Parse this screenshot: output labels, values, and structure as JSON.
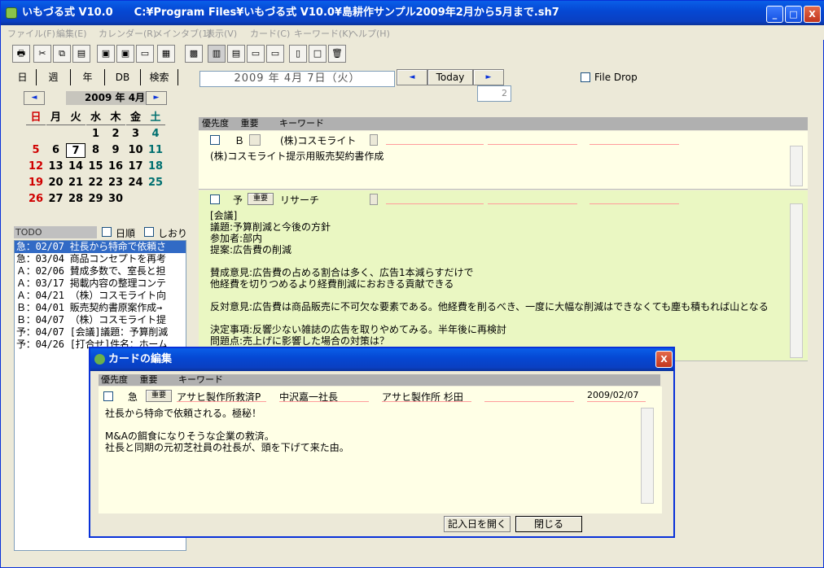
{
  "window": {
    "title": "いもづる式 V10.0　　C:¥Program Files¥いもづる式 V10.0¥島耕作サンプル2009年2月から5月まで.sh7",
    "min": "_",
    "max": "□",
    "close": "X"
  },
  "menu": [
    "ファイル(F)",
    "編集(E)",
    "カレンダー(R)",
    "メインタブ(1)",
    "表示(V)",
    "カード(C)",
    "キーワード(K)",
    "ヘルプ(H)"
  ],
  "toolbar": {
    "counter": "2"
  },
  "tabs": [
    "日",
    "週",
    "年",
    "DB",
    "検索"
  ],
  "calendar": {
    "month": "2009 年 4月",
    "weekdays": [
      "日",
      "月",
      "火",
      "水",
      "木",
      "金",
      "土"
    ],
    "weeks": [
      [
        "",
        "",
        "",
        "1",
        "2",
        "3",
        "4"
      ],
      [
        "5",
        "6",
        "7",
        "8",
        "9",
        "10",
        "11"
      ],
      [
        "12",
        "13",
        "14",
        "15",
        "16",
        "17",
        "18"
      ],
      [
        "19",
        "20",
        "21",
        "22",
        "23",
        "24",
        "25"
      ],
      [
        "26",
        "27",
        "28",
        "29",
        "30",
        "",
        ""
      ]
    ],
    "today": "7"
  },
  "todo": {
    "header": "TODO",
    "opt1": "日順",
    "opt2": "しおり",
    "items": [
      "急：02/07 社長から特命で依頼さ",
      "急：03/04 商品コンセプトを再考",
      "Ａ：02/06 賛成多数で、室長と担",
      "Ａ：03/17 掲載内容の整理コンテ",
      "Ａ：04/21 （株）コスモライト向",
      "Ｂ：04/01 販売契約書原案作成→",
      "Ｂ：04/07 （株）コスモライト提",
      "予：04/07 [会議]議題：予算削減",
      "予：04/26 [打合せ]件名：ホーム"
    ]
  },
  "dateview": {
    "date": "2009 年 4月 7日（火）",
    "prev": "◄",
    "today": "Today",
    "next": "►",
    "filedrop": "File Drop"
  },
  "cards": {
    "header": "優先度　 重要　　 キーワード",
    "card1": {
      "priority": "Ｂ",
      "keyword": "(株)コスモライト",
      "body": "(株)コスモライト提示用販売契約書作成"
    },
    "card2": {
      "priority": "予",
      "important": "重要",
      "keyword": "リサーチ",
      "body": "[会議]\n議題:予算削減と今後の方針\n参加者:部内\n提案:広告費の削減\n\n賛成意見:広告費の占める割合は多く、広告1本減らすだけで\n他経費を切りつめるより経費削減におおきる貢献できる\n\n反対意見:広告費は商品販売に不可欠な要素である。他経費を削るべき、一度に大幅な削減はできなくても塵も積もれば山となる\n\n決定事項:反響少ない雑誌の広告を取りやめてみる。半年後に再検討\n問題点:売上げに影響した場合の対策は？"
    }
  },
  "dialog": {
    "title": "カードの編集",
    "close": "X",
    "header": "優先度　 重要　　 キーワード",
    "priority": "急",
    "important": "重要",
    "keywords": [
      "アサヒ製作所救済P",
      "中沢嘉一社長",
      "アサヒ製作所 杉田"
    ],
    "date": "2009/02/07",
    "body": "社長から特命で依頼される。極秘！\n\nM&Aの餌食になりそうな企業の救済。\n社長と同期の元初芝社員の社長が、頭を下げて来た由。",
    "open_btn": "記入日を開く",
    "close_btn": "閉じる"
  }
}
